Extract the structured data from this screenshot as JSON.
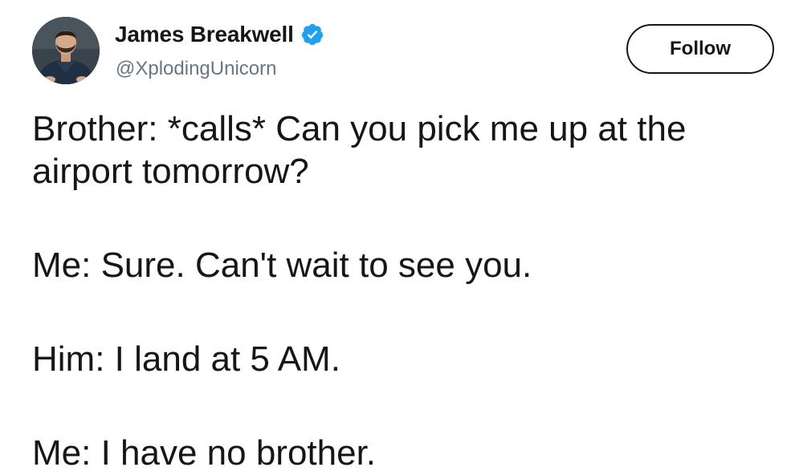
{
  "author": {
    "display_name": "James Breakwell",
    "handle": "@XplodingUnicorn",
    "verified": true,
    "verified_icon": "verified-badge-icon",
    "verified_color": "#1da1f2"
  },
  "actions": {
    "follow_label": "Follow"
  },
  "tweet": {
    "lines": [
      "Brother: *calls* Can you pick me up at the airport tomorrow?",
      "Me: Sure. Can't wait to see you.",
      "Him: I land at 5 AM.",
      "Me: I have no brother."
    ]
  },
  "colors": {
    "text": "#14171a",
    "secondary": "#657786",
    "accent": "#1da1f2"
  }
}
